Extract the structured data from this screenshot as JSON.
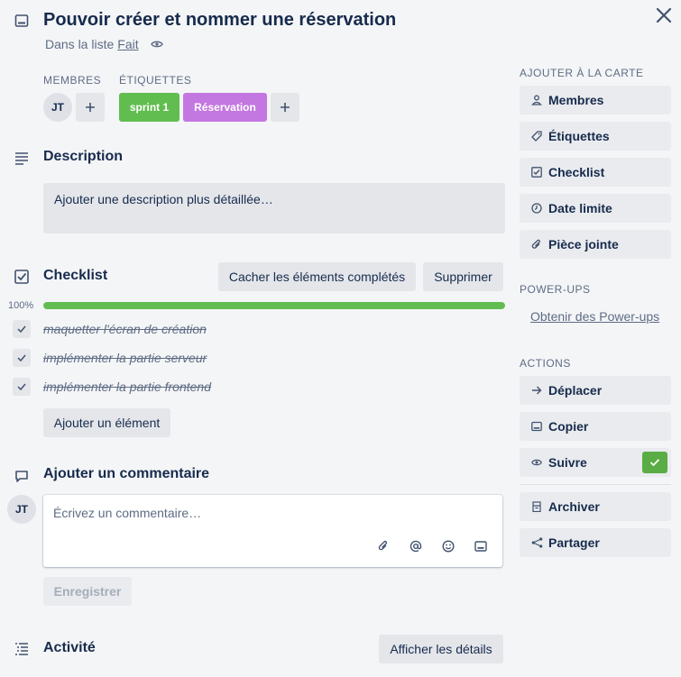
{
  "card": {
    "title": "Pouvoir créer et nommer une réservation",
    "list_prefix": "Dans la liste",
    "list_name": "Fait"
  },
  "members": {
    "label": "MEMBRES",
    "avatar_initials": "JT"
  },
  "labels": {
    "label": "ÉTIQUETTES",
    "items": [
      {
        "text": "sprint 1",
        "color": "#61bd4f"
      },
      {
        "text": "Réservation",
        "color": "#c377e0"
      }
    ]
  },
  "description": {
    "heading": "Description",
    "placeholder": "Ajouter une description plus détaillée…"
  },
  "checklist": {
    "heading": "Checklist",
    "hide_button": "Cacher les éléments complétés",
    "delete_button": "Supprimer",
    "progress_label": "100%",
    "progress": 1.0,
    "items": [
      {
        "text": "maquetter l'écran de création",
        "done": true
      },
      {
        "text": "implémenter la partie serveur",
        "done": true
      },
      {
        "text": "implémenter la partie frontend",
        "done": true
      }
    ],
    "add_item_button": "Ajouter un élément"
  },
  "comment": {
    "heading": "Ajouter un commentaire",
    "avatar_initials": "JT",
    "placeholder": "Écrivez un commentaire…",
    "save_button": "Enregistrer",
    "tools": [
      "attachment-icon",
      "mention-icon",
      "emoji-icon",
      "card-icon"
    ]
  },
  "activity": {
    "heading": "Activité",
    "details_button": "Afficher les détails"
  },
  "sidebar": {
    "add_heading": "AJOUTER À LA CARTE",
    "add_items": [
      {
        "label": "Membres",
        "icon": "person-icon"
      },
      {
        "label": "Étiquettes",
        "icon": "tag-icon"
      },
      {
        "label": "Checklist",
        "icon": "checkbox-icon"
      },
      {
        "label": "Date limite",
        "icon": "clock-icon"
      },
      {
        "label": "Pièce jointe",
        "icon": "paperclip-icon"
      }
    ],
    "powerups_heading": "POWER-UPS",
    "powerups_link": "Obtenir des Power-ups",
    "actions_heading": "ACTIONS",
    "actions": [
      {
        "label": "Déplacer",
        "icon": "arrow-right-icon"
      },
      {
        "label": "Copier",
        "icon": "card-icon"
      },
      {
        "label": "Suivre",
        "icon": "eye-icon",
        "active": true
      },
      {
        "label": "Archiver",
        "icon": "archive-icon"
      },
      {
        "label": "Partager",
        "icon": "share-icon"
      }
    ]
  },
  "colors": {
    "green": "#61bd4f",
    "purple": "#c377e0",
    "follow_active": "#5aac44"
  }
}
